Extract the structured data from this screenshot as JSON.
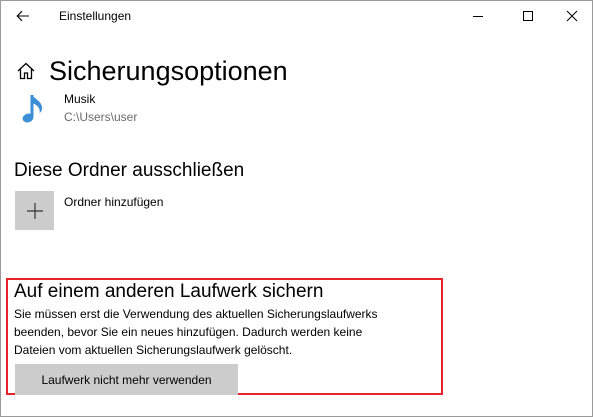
{
  "window": {
    "title": "Einstellungen"
  },
  "page": {
    "title": "Sicherungsoptionen"
  },
  "folder": {
    "name": "Musik",
    "path": "C:\\Users\\user"
  },
  "exclude_section": {
    "heading": "Diese Ordner ausschließen",
    "add_label": "Ordner hinzufügen"
  },
  "other_drive_section": {
    "heading": "Auf einem anderen Laufwerk sichern",
    "info_lines": [
      "Sie müssen erst die Verwendung des aktuellen Sicherungslaufwerks",
      "beenden, bevor Sie ein neues hinzufügen. Dadurch werden keine",
      "Dateien vom aktuellen Sicherungslaufwerk gelöscht."
    ],
    "button_label": "Laufwerk nicht mehr verwenden"
  },
  "icons": {
    "back": "back-arrow-icon",
    "minimize": "minimize-icon",
    "maximize": "maximize-icon",
    "close": "close-icon",
    "home": "home-icon",
    "music": "music-note-icon",
    "add": "plus-icon"
  },
  "colors": {
    "accent": "#3a8fd6",
    "highlight": "#e8242a",
    "button_bg": "#cccccc",
    "secondary_text": "#6b6b6b"
  }
}
